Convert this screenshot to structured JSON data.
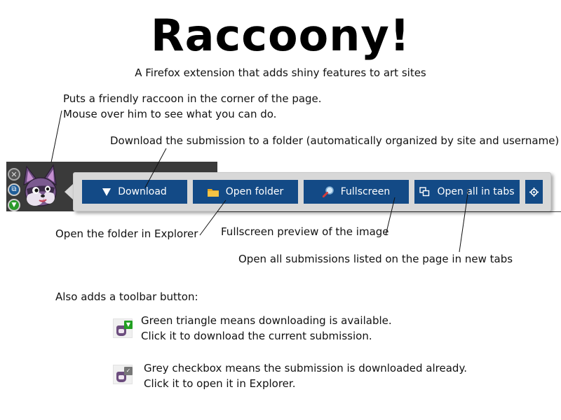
{
  "header": {
    "title": "Raccoony!",
    "subtitle": "A Firefox extension that adds shiny features to art sites"
  },
  "notes": {
    "raccoon_line1": "Puts a friendly raccoon in the corner of the page.",
    "raccoon_line2": "Mouse over him to see what you can do.",
    "download": "Download the submission to a folder (automatically organized by site and username)",
    "open_folder": "Open the folder in Explorer",
    "fullscreen": "Fullscreen preview of the image",
    "open_tabs": "Open all submissions listed on the page in new tabs",
    "toolbar_intro": "Also adds a toolbar button:",
    "green_line1": "Green triangle means downloading is available.",
    "green_line2": "Click it to download the current submission.",
    "grey_line1": "Grey checkbox means the submission is downloaded already.",
    "grey_line2": "Click it to open it in Explorer."
  },
  "toolbar": {
    "download_label": "Download",
    "open_folder_label": "Open folder",
    "fullscreen_label": "Fullscreen",
    "open_tabs_label": "Open all in tabs",
    "icons": {
      "download": "triangle-down-icon",
      "open_folder": "folder-icon",
      "fullscreen": "magnifier-icon",
      "open_tabs": "tabs-icon",
      "settings": "gear-icon"
    }
  },
  "side_buttons": [
    "close-icon",
    "tabs-icon",
    "download-icon"
  ],
  "colors": {
    "button_bg": "#134a86",
    "button_text": "#ffffff",
    "toolbar_bg": "#d8d8d8",
    "page_dark": "#3a3a3a",
    "green_badge": "#22a022",
    "grey_badge": "#777777"
  }
}
